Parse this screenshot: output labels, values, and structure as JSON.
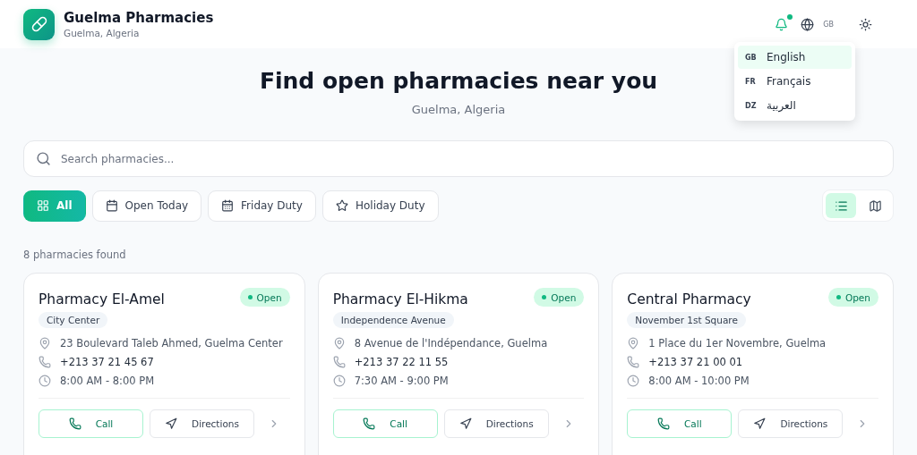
{
  "header": {
    "title": "Guelma Pharmacies",
    "subtitle": "Guelma, Algeria",
    "notification_dot": true,
    "language_code": "GB"
  },
  "language_menu": [
    {
      "code": "GB",
      "label": "English",
      "selected": true
    },
    {
      "code": "FR",
      "label": "Français",
      "selected": false
    },
    {
      "code": "DZ",
      "label": "العربية",
      "selected": false
    }
  ],
  "hero": {
    "title": "Find open pharmacies near you",
    "subtitle": "Guelma, Algeria"
  },
  "search": {
    "placeholder": "Search pharmacies..."
  },
  "filters": [
    {
      "kind": "grid",
      "label": "All",
      "selected": true
    },
    {
      "kind": "calendar",
      "label": "Open Today",
      "selected": false
    },
    {
      "kind": "calendar-days",
      "label": "Friday Duty",
      "selected": false
    },
    {
      "kind": "star",
      "label": "Holiday Duty",
      "selected": false
    }
  ],
  "views": [
    {
      "kind": "list",
      "selected": true
    },
    {
      "kind": "map",
      "selected": false
    }
  ],
  "result_count": "8 pharmacies found",
  "pharmacies": [
    {
      "name": "Pharmacy El-Amel",
      "status": "Open",
      "area": "City Center",
      "address": "23 Boulevard Taleb Ahmed, Guelma Center",
      "phone": "+213 37 21 45 67",
      "hours": "8:00 AM - 8:00 PM",
      "call": "Call",
      "directions": "Directions"
    },
    {
      "name": "Pharmacy El-Hikma",
      "status": "Open",
      "area": "Independence Avenue",
      "address": "8 Avenue de l'Indépendance, Guelma",
      "phone": "+213 37 22 11 55",
      "hours": "7:30 AM - 9:00 PM",
      "call": "Call",
      "directions": "Directions"
    },
    {
      "name": "Central Pharmacy",
      "status": "Open",
      "area": "November 1st Square",
      "address": "1 Place du 1er Novembre, Guelma",
      "phone": "+213 37 21 00 01",
      "hours": "8:00 AM - 10:00 PM",
      "call": "Call",
      "directions": "Directions"
    }
  ]
}
